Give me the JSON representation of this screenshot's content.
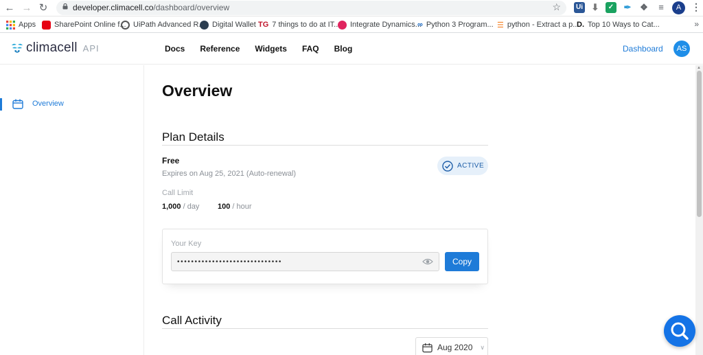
{
  "browser": {
    "url_host": "developer.climacell.co",
    "url_path": "/dashboard/overview",
    "profile_initial": "A",
    "bookmarks": [
      {
        "label": "Apps",
        "color": "#e8453c"
      },
      {
        "label": "SharePoint Online f...",
        "color": "#e60012"
      },
      {
        "label": "UiPath Advanced R...",
        "color": "#555555"
      },
      {
        "label": "Digital Wallet",
        "color": "#2c3e50"
      },
      {
        "label": "7 things to do at IT...",
        "color": "#c0142b"
      },
      {
        "label": "Integrate Dynamics...",
        "color": "#e0245e"
      },
      {
        "label": "Python 3 Program...",
        "color": "#1565c0"
      },
      {
        "label": "python - Extract a p...",
        "color": "#f48024"
      },
      {
        "label": "Top 10 Ways to Cat...",
        "color": "#111111"
      }
    ]
  },
  "header": {
    "logo": "climacell",
    "logo_suffix": "API",
    "nav": [
      "Docs",
      "Reference",
      "Widgets",
      "FAQ",
      "Blog"
    ],
    "dashboard_link": "Dashboard",
    "avatar_initials": "AS"
  },
  "sidebar": {
    "items": [
      {
        "label": "Overview",
        "icon": "calendar-icon",
        "active": true
      }
    ]
  },
  "main": {
    "title": "Overview",
    "plan_heading": "Plan Details",
    "plan_name": "Free",
    "expires": "Expires on Aug 25, 2021 (Auto-renewal)",
    "status": "ACTIVE",
    "call_limit_label": "Call Limit",
    "limit_day_value": "1,000",
    "limit_day_unit": " / day",
    "limit_hour_value": "100",
    "limit_hour_unit": " / hour",
    "key_label": "Your Key",
    "key_value": "••••••••••••••••••••••••••••••",
    "copy_label": "Copy",
    "activity_heading": "Call Activity",
    "month_select": "Aug 2020"
  },
  "colors": {
    "accent": "#1e7bd8",
    "help_button": "#1473e6"
  }
}
